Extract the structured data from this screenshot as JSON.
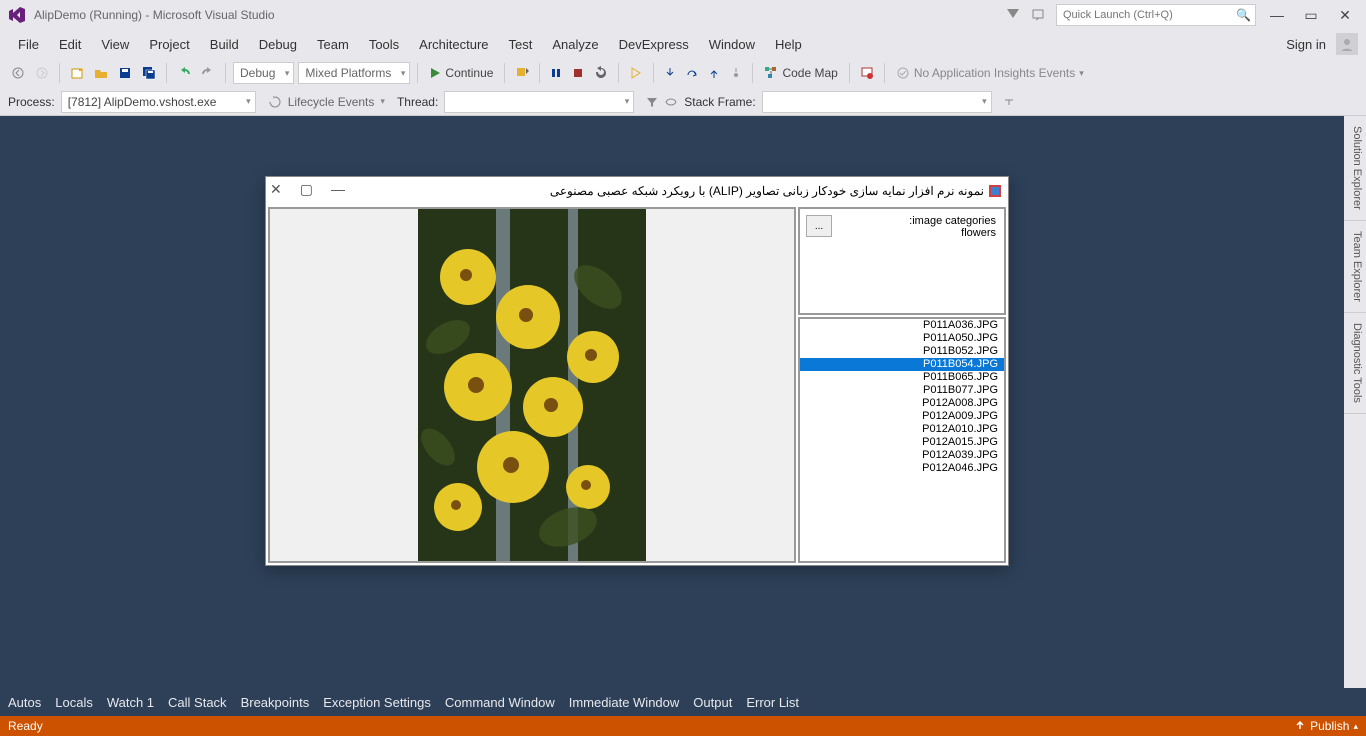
{
  "titlebar": {
    "title": "AlipDemo (Running) - Microsoft Visual Studio",
    "quicklaunch_placeholder": "Quick Launch (Ctrl+Q)"
  },
  "menubar": {
    "items": [
      "File",
      "Edit",
      "View",
      "Project",
      "Build",
      "Debug",
      "Team",
      "Tools",
      "Architecture",
      "Test",
      "Analyze",
      "DevExpress",
      "Window",
      "Help"
    ],
    "signin": "Sign in"
  },
  "toolbar": {
    "config": "Debug",
    "platform": "Mixed Platforms",
    "continue": "Continue",
    "codemap": "Code Map",
    "insights": "No Application Insights Events"
  },
  "debugbar": {
    "process_label": "Process:",
    "process_value": "[7812] AlipDemo.vshost.exe",
    "lifecycle": "Lifecycle Events",
    "thread_label": "Thread:",
    "stackframe_label": "Stack Frame:"
  },
  "sidetabs": [
    "Solution Explorer",
    "Team Explorer",
    "Diagnostic Tools"
  ],
  "appwin": {
    "title": "نمونه نرم افزار نمایه سازی خودکار زبانی تصاویر (ALIP) با رویکرد شبکه عصبی مصنوعی",
    "browse": "...",
    "cat_label": ":image categories",
    "cat_value": "flowers",
    "files": [
      "P011A036.JPG",
      "P011A050.JPG",
      "P011B052.JPG",
      "P011B054.JPG",
      "P011B065.JPG",
      "P011B077.JPG",
      "P012A008.JPG",
      "P012A009.JPG",
      "P012A010.JPG",
      "P012A015.JPG",
      "P012A039.JPG",
      "P012A046.JPG"
    ],
    "selected_index": 3
  },
  "bottomtabs": [
    "Autos",
    "Locals",
    "Watch 1",
    "Call Stack",
    "Breakpoints",
    "Exception Settings",
    "Command Window",
    "Immediate Window",
    "Output",
    "Error List"
  ],
  "statusbar": {
    "ready": "Ready",
    "publish": "Publish"
  }
}
